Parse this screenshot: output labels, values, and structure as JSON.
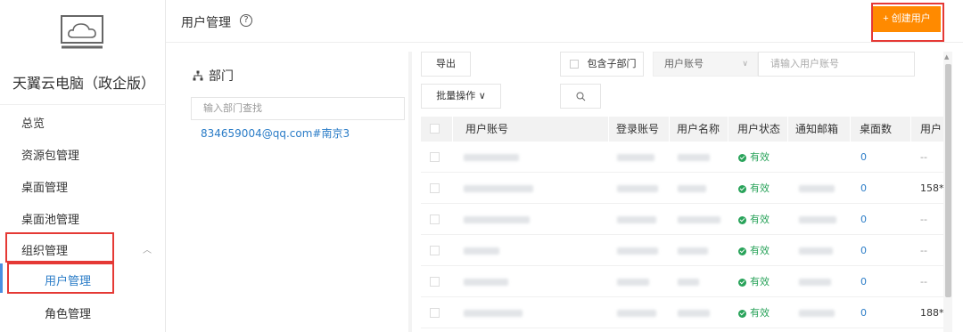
{
  "sidebar": {
    "app_title": "天翼云电脑（政企版）",
    "items": [
      {
        "label": "总览"
      },
      {
        "label": "资源包管理"
      },
      {
        "label": "桌面管理"
      },
      {
        "label": "桌面池管理"
      },
      {
        "label": "组织管理"
      }
    ],
    "sub_items": [
      {
        "label": "用户管理"
      },
      {
        "label": "角色管理"
      }
    ]
  },
  "header": {
    "title": "用户管理",
    "help": "?",
    "create_button": "+ 创建用户"
  },
  "dept": {
    "title": "部门",
    "search_placeholder": "输入部门查找",
    "node": "834659004@qq.com#南京3"
  },
  "toolbar": {
    "export": "导出",
    "batch": "批量操作 ∨",
    "include_sub": "包含子部门",
    "field_select": "用户账号",
    "search_placeholder": "请输入用户账号"
  },
  "table": {
    "columns": [
      "用户账号",
      "登录账号",
      "用户名称",
      "用户状态",
      "通知邮箱",
      "桌面数",
      "用户"
    ],
    "rows": [
      {
        "status": "有效",
        "desktops": "0",
        "phone": "--"
      },
      {
        "status": "有效",
        "desktops": "0",
        "phone": "158*"
      },
      {
        "status": "有效",
        "desktops": "0",
        "phone": "--"
      },
      {
        "status": "有效",
        "desktops": "0",
        "phone": "--"
      },
      {
        "status": "有效",
        "desktops": "0",
        "phone": "--"
      },
      {
        "status": "有效",
        "desktops": "0",
        "phone": "188*"
      }
    ]
  },
  "colors": {
    "accent": "#ff8a00",
    "highlight_border": "#e53935",
    "link": "#2a7cc7",
    "status_ok": "#29a35a"
  }
}
